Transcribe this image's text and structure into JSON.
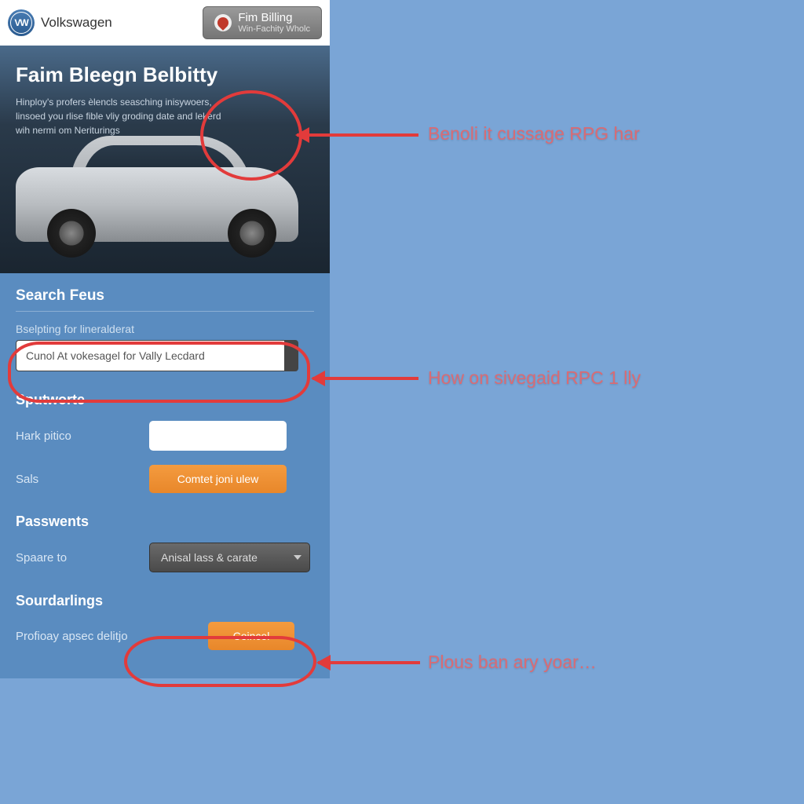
{
  "header": {
    "brand": "Volkswagen",
    "billing": {
      "main": "Fim Billing",
      "sub": "Win-Fachity Wholc"
    }
  },
  "hero": {
    "title": "Faim Bleegn Belbitty",
    "copy": "Hinploy's profers èlencls seasching inisywoers, linsoed you rlise fible vliy groding date and lekerd wih nermi om Neriturings"
  },
  "search": {
    "title": "Search Feus",
    "field_label": "Bselpting for lineralderat",
    "field_value": "Cunol At vokesagel for Vally Lecdard"
  },
  "sputworte": {
    "title": "Sputworte",
    "hark_label": "Hark pitico",
    "sals_label": "Sals",
    "sals_button": "Comtet joni ulew"
  },
  "passwents": {
    "title": "Passwents",
    "spaare_label": "Spaare to",
    "spaare_value": "Anisal lass & carate"
  },
  "sourdarlings": {
    "title": "Sourdarlings",
    "row_label": "Profioay apsec delitjo",
    "button": "Coincel"
  },
  "annotations": {
    "a1": "Benoli it cussage RPG har",
    "a2": "How on sivegaid RPC 1 lly",
    "a3": "Plous ban ary yoar…"
  }
}
